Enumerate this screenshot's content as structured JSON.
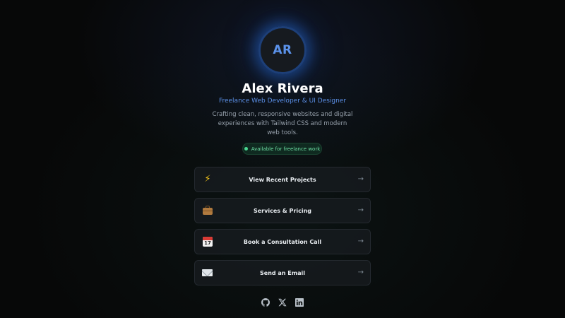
{
  "profile": {
    "initials": "AR",
    "name": "Alex Rivera",
    "role": "Freelance Web Developer & UI Designer",
    "bio": "Crafting clean, responsive websites and digital experiences with Tailwind CSS and modern web tools.",
    "status": "Available for freelance work"
  },
  "links": [
    {
      "label": "View Recent Projects",
      "icon": "lightning-icon"
    },
    {
      "label": "Services & Pricing",
      "icon": "briefcase-icon"
    },
    {
      "label": "Book a Consultation Call",
      "icon": "calendar-icon",
      "icon_text": "17"
    },
    {
      "label": "Send an Email",
      "icon": "envelope-icon"
    }
  ],
  "arrow_glyph": "→",
  "socials": [
    "github-icon",
    "x-icon",
    "linkedin-icon"
  ],
  "colors": {
    "accent": "#5b8fe6",
    "status": "#4ad891",
    "background": "#070808"
  }
}
